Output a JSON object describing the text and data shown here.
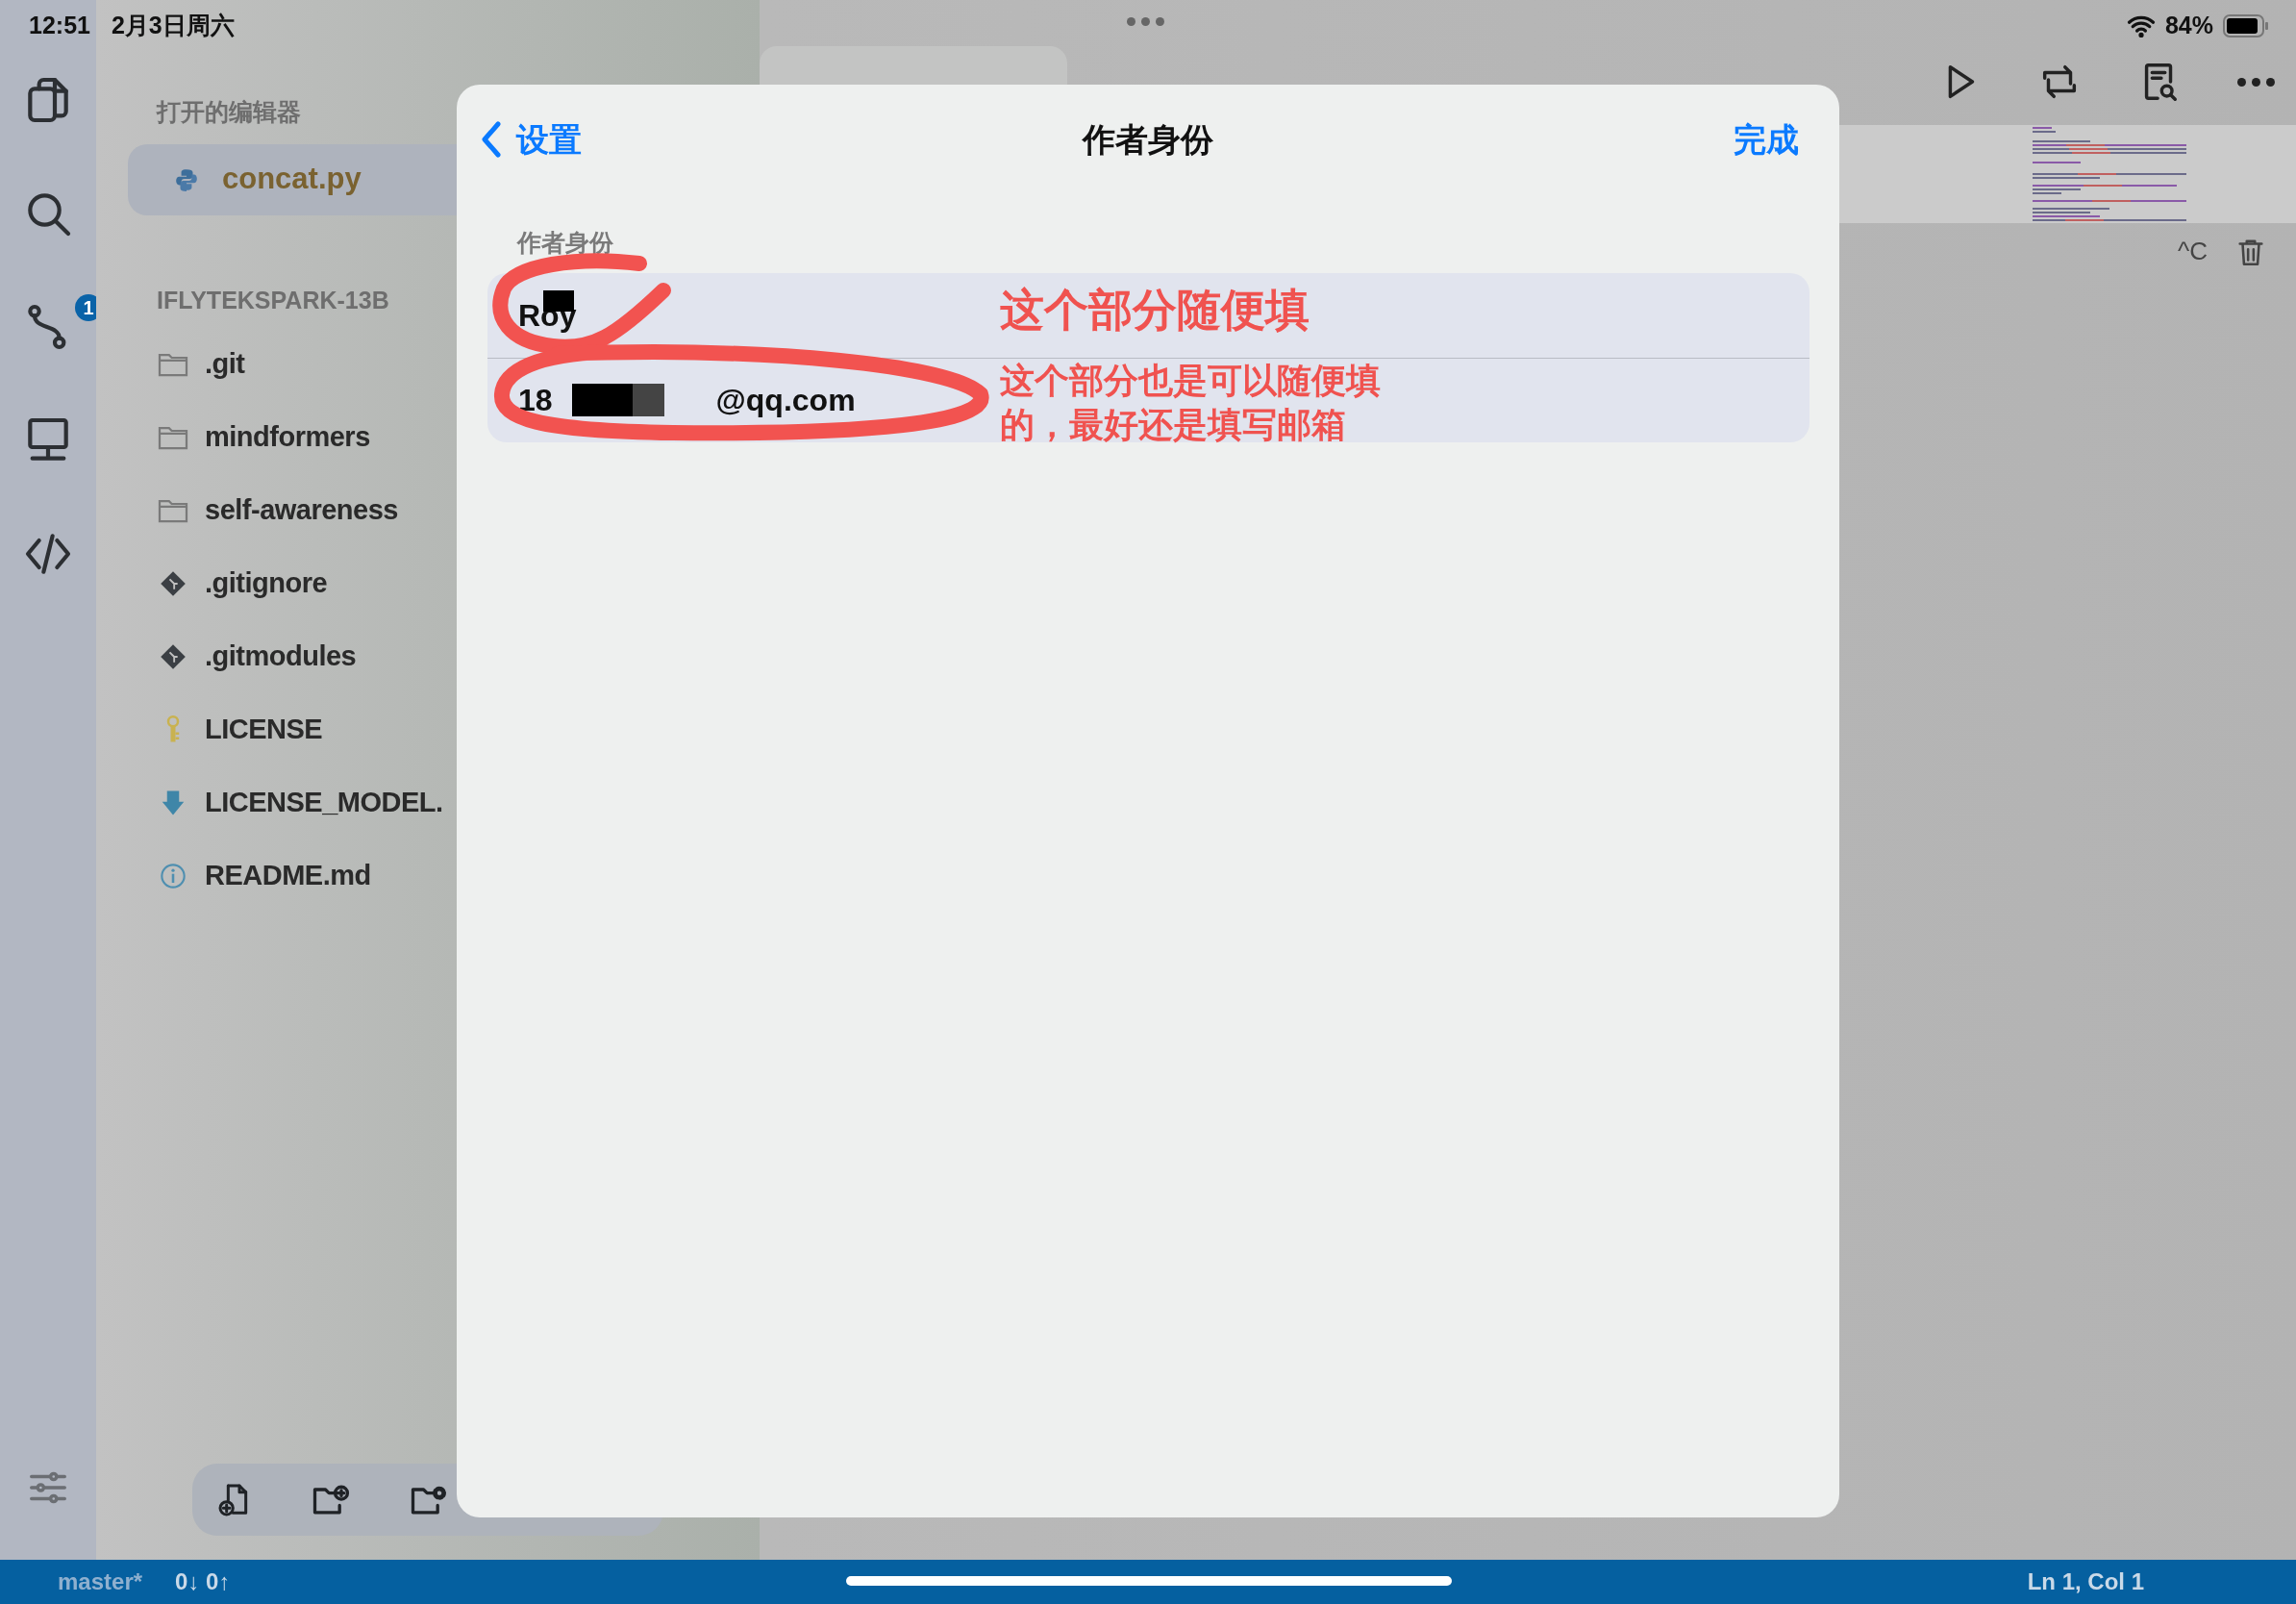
{
  "status_bar": {
    "time": "12:51",
    "date": "2月3日周六",
    "battery": "84%"
  },
  "activity_bar": [
    {
      "kind": "files"
    },
    {
      "kind": "search"
    },
    {
      "kind": "source-control",
      "badge": "1"
    },
    {
      "kind": "remote"
    },
    {
      "kind": "code"
    }
  ],
  "sidebar": {
    "open_editors_title": "打开的编辑器",
    "open_editors": [
      {
        "label": "concat.py",
        "selected": true
      }
    ],
    "workspace_title": "IFLYTEKSPARK-13B",
    "files": [
      {
        "kind": "folder",
        "label": ".git"
      },
      {
        "kind": "folder",
        "label": "mindformers"
      },
      {
        "kind": "folder",
        "label": "self-awareness"
      },
      {
        "kind": "git",
        "label": ".gitignore"
      },
      {
        "kind": "git",
        "label": ".gitmodules"
      },
      {
        "kind": "license",
        "label": "LICENSE"
      },
      {
        "kind": "download",
        "label": "LICENSE_MODEL."
      },
      {
        "kind": "info",
        "label": "README.md"
      }
    ]
  },
  "modal": {
    "back": "设置",
    "title": "作者身份",
    "done": "完成",
    "section_label": "作者身份",
    "rows": [
      {
        "kind": "name",
        "text": "Roy"
      },
      {
        "kind": "email",
        "prefix": "18",
        "suffix": "@qq.com"
      }
    ]
  },
  "annotations": [
    {
      "text": "这个部分随便填"
    },
    {
      "text": "这个部分也是可以随便填的，最好还是填写邮箱"
    }
  ],
  "editor": {
    "interrupt": "^C"
  },
  "bottom_bar": {
    "branch": "master*",
    "sync": "0↓ 0↑",
    "position": "Ln 1, Col 1"
  }
}
